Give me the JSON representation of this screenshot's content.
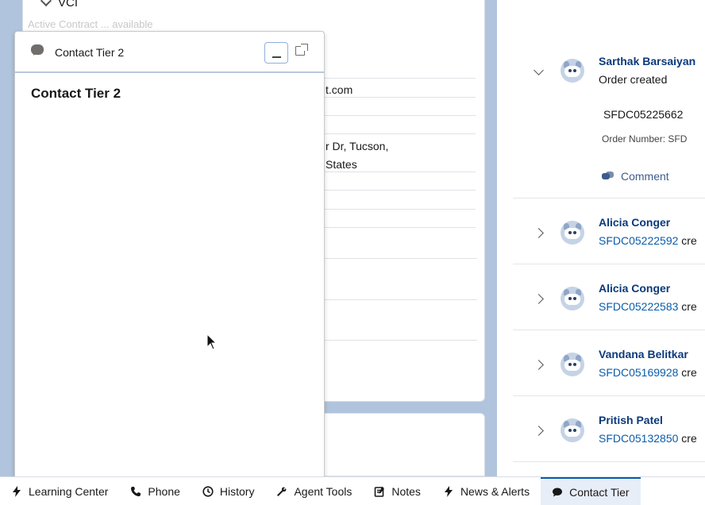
{
  "background": {
    "section_label": "VCI",
    "faded_text": "Active Contract ... available",
    "email_fragment": "t.com",
    "address_line1": "r Dr, Tucson,",
    "address_line2": "States"
  },
  "panel": {
    "header_title": "Contact Tier 2",
    "body_title": "Contact Tier 2"
  },
  "feed": {
    "items": [
      {
        "name": "Sarthak Barsaiyan",
        "subtitle": "Order created",
        "expanded": true,
        "order_id": "SFDC05225662",
        "order_label": "Order Number: SFD",
        "comment_label": "Comment"
      },
      {
        "name": "Alicia Conger",
        "link": "SFDC05222592",
        "suffix": " cre",
        "expanded": false
      },
      {
        "name": "Alicia Conger",
        "link": "SFDC05222583",
        "suffix": " cre",
        "expanded": false
      },
      {
        "name": "Vandana Belitkar",
        "link": "SFDC05169928",
        "suffix": " cre",
        "expanded": false
      },
      {
        "name": "Pritish Patel",
        "link": "SFDC05132850",
        "suffix": " cre",
        "expanded": false
      }
    ]
  },
  "utility_bar": {
    "items": [
      {
        "label": "Learning Center",
        "icon": "bolt-icon"
      },
      {
        "label": "Phone",
        "icon": "phone-icon"
      },
      {
        "label": "History",
        "icon": "clock-icon"
      },
      {
        "label": "Agent Tools",
        "icon": "wrench-icon"
      },
      {
        "label": "Notes",
        "icon": "notes-icon"
      },
      {
        "label": "News & Alerts",
        "icon": "bolt-icon"
      },
      {
        "label": "Contact Tier",
        "icon": "chat-icon",
        "active": true
      }
    ]
  },
  "colors": {
    "page_background": "#b0c4de",
    "link": "#0b5cab",
    "name": "#0b3a7a",
    "accent": "#0b5cab"
  }
}
